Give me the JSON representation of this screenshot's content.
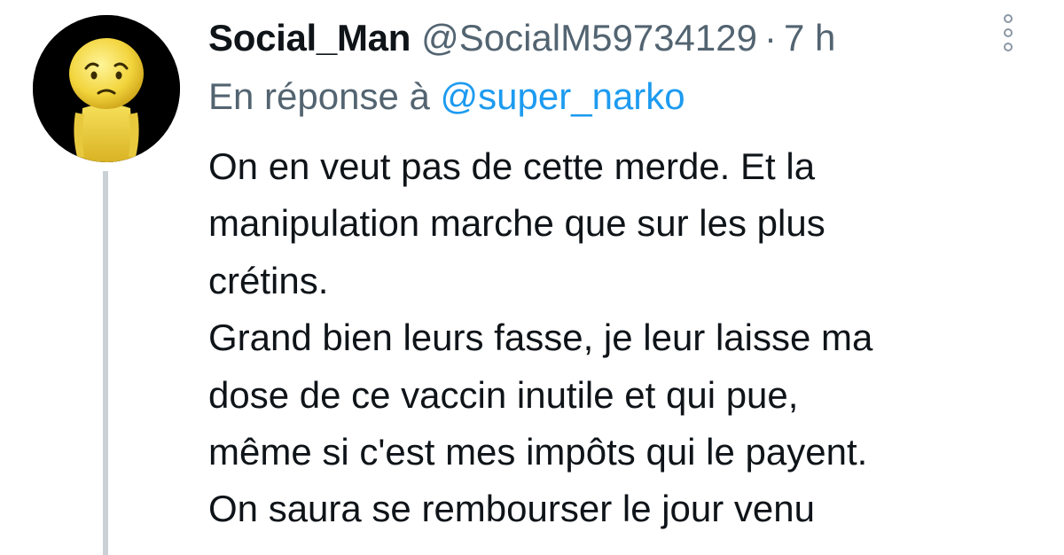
{
  "tweet": {
    "author_name": "Social_Man",
    "author_handle": "@SocialM59734129",
    "separator": "·",
    "time": "7 h",
    "reply_prefix": "En réponse à",
    "reply_mention": "@super_narko",
    "lines": [
      "On en veut pas de cette merde. Et la",
      "manipulation marche que sur les plus",
      "crétins.",
      "Grand bien leurs fasse, je leur laisse ma",
      "dose de ce vaccin inutile et qui pue,",
      "même si c'est mes impôts qui le payent.",
      "On saura se rembourser le jour venu"
    ]
  },
  "icons": {
    "avatar": "sad-yellow-figure-avatar",
    "more": "more-options-icon"
  },
  "colors": {
    "text": "#0f1419",
    "secondary": "#536471",
    "link": "#1d9bf0",
    "thread_line": "#c9d1d6"
  }
}
